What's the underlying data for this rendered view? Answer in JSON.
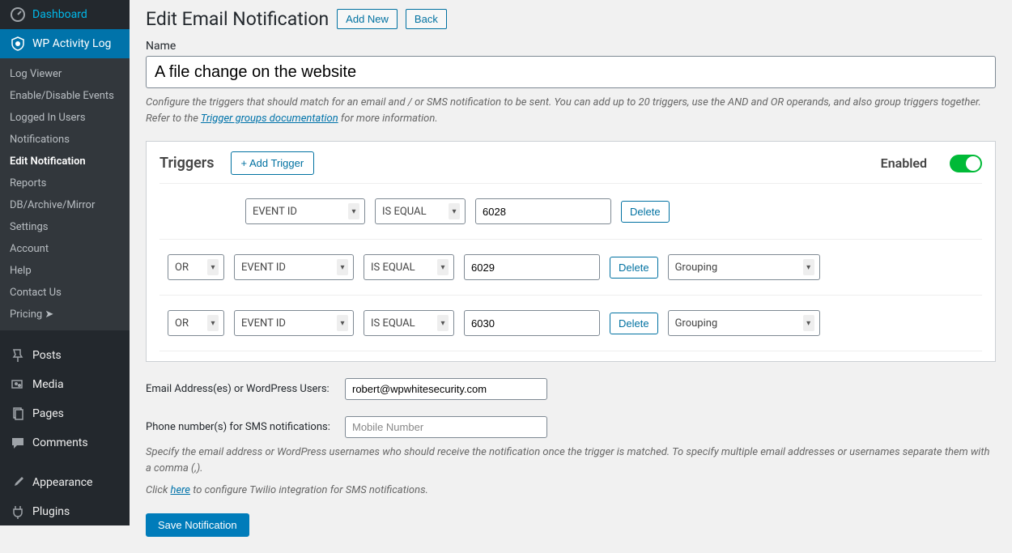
{
  "sidebar": {
    "collapsed": false,
    "top": [
      {
        "icon": "dashboard",
        "label": "Dashboard"
      },
      {
        "icon": "shield",
        "label": "WP Activity Log",
        "active": true
      }
    ],
    "submenu": [
      "Log Viewer",
      "Enable/Disable Events",
      "Logged In Users",
      "Notifications",
      "Edit Notification",
      "Reports",
      "DB/Archive/Mirror",
      "Settings",
      "Account",
      "Help",
      "Contact Us",
      "Pricing  ➤"
    ],
    "submenu_current": "Edit Notification",
    "bottom": [
      {
        "icon": "pin",
        "label": "Posts"
      },
      {
        "icon": "media",
        "label": "Media"
      },
      {
        "icon": "page",
        "label": "Pages"
      },
      {
        "icon": "comment",
        "label": "Comments"
      },
      {
        "icon": "brush",
        "label": "Appearance"
      },
      {
        "icon": "plug",
        "label": "Plugins"
      }
    ]
  },
  "page": {
    "title": "Edit Email Notification",
    "add_new": "Add New",
    "back": "Back",
    "name_label": "Name",
    "name_value": "A file change on the website",
    "config_help_pre": "Configure the triggers that should match for an email and / or SMS notification to be sent. You can add up to 20 triggers, use the AND and OR operands, and also group triggers together. Refer to the ",
    "config_help_link": "Trigger groups documentation",
    "config_help_post": " for more information."
  },
  "triggers": {
    "title": "Triggers",
    "add_label": "+ Add Trigger",
    "enabled_label": "Enabled",
    "enabled": true,
    "delete_label": "Delete",
    "operator_option": "OR",
    "field_option": "EVENT ID",
    "compare_option": "IS EQUAL",
    "group_option": "Grouping",
    "rows": [
      {
        "value": "6028",
        "has_operator": false,
        "has_group": false
      },
      {
        "value": "6029",
        "has_operator": true,
        "has_group": true
      },
      {
        "value": "6030",
        "has_operator": true,
        "has_group": true
      }
    ]
  },
  "recipients": {
    "email_label": "Email Address(es) or WordPress Users:",
    "email_value": "robert@wpwhitesecurity.com",
    "phone_label": "Phone number(s) for SMS notifications:",
    "phone_placeholder": "Mobile Number",
    "note1": "Specify the email address or WordPress usernames who should receive the notification once the trigger is matched. To specify multiple email addresses or usernames separate them with a comma (,).",
    "note2_pre": "Click ",
    "note2_link": "here",
    "note2_post": " to configure Twilio integration for SMS notifications.",
    "save_label": "Save Notification"
  }
}
